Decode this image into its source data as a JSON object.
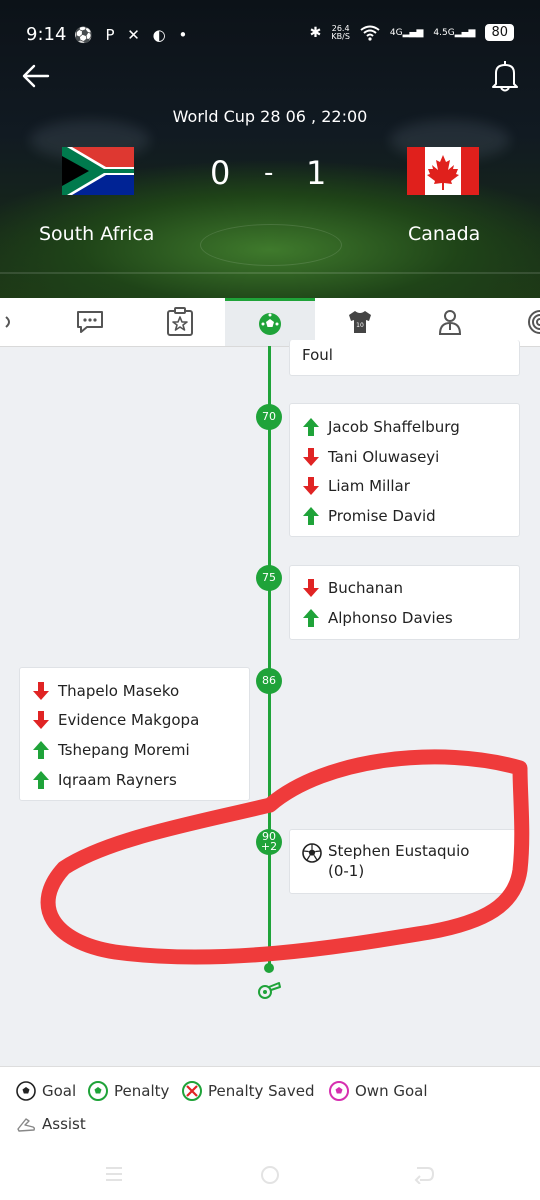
{
  "status_bar": {
    "time": "9:14",
    "net_speed": "26.4\nKB/S",
    "network_4g": "4G",
    "network_45g": "4.5G",
    "battery": "80"
  },
  "match": {
    "info": "World Cup 28 06 , 22:00",
    "home_team": "South Africa",
    "away_team": "Canada",
    "home_score": "0",
    "separator": "-",
    "away_score": "1"
  },
  "tabs": [
    "odds-icon",
    "chat-icon",
    "lineup-board-icon",
    "events-ball-icon",
    "jersey-icon",
    "person-icon",
    "more-icon"
  ],
  "events": {
    "top_card_text": "Foul",
    "m70": {
      "minute": "70",
      "rows": [
        {
          "type": "in",
          "name": "Jacob Shaffelburg"
        },
        {
          "type": "out",
          "name": "Tani Oluwaseyi"
        },
        {
          "type": "out",
          "name": "Liam Millar"
        },
        {
          "type": "in",
          "name": "Promise David"
        }
      ]
    },
    "m75": {
      "minute": "75",
      "rows": [
        {
          "type": "out",
          "name": "Buchanan"
        },
        {
          "type": "in",
          "name": "Alphonso Davies"
        }
      ]
    },
    "m86": {
      "minute": "86",
      "rows": [
        {
          "type": "out",
          "name": "Thapelo Maseko"
        },
        {
          "type": "out",
          "name": "Evidence Makgopa"
        },
        {
          "type": "in",
          "name": "Tshepang Moremi"
        },
        {
          "type": "in",
          "name": "Iqraam Rayners"
        }
      ]
    },
    "m90": {
      "minute_top": "90",
      "minute_bottom": "+2",
      "scorer": "Stephen Eustaquio",
      "score": "(0-1)"
    }
  },
  "legend": {
    "goal": "Goal",
    "penalty": "Penalty",
    "penalty_saved": "Penalty Saved",
    "own_goal": "Own Goal",
    "assist": "Assist"
  },
  "colors": {
    "accent": "#1fa339",
    "sub_in": "#1fa339",
    "sub_out": "#e02424",
    "annotation": "#ef3b3b"
  }
}
